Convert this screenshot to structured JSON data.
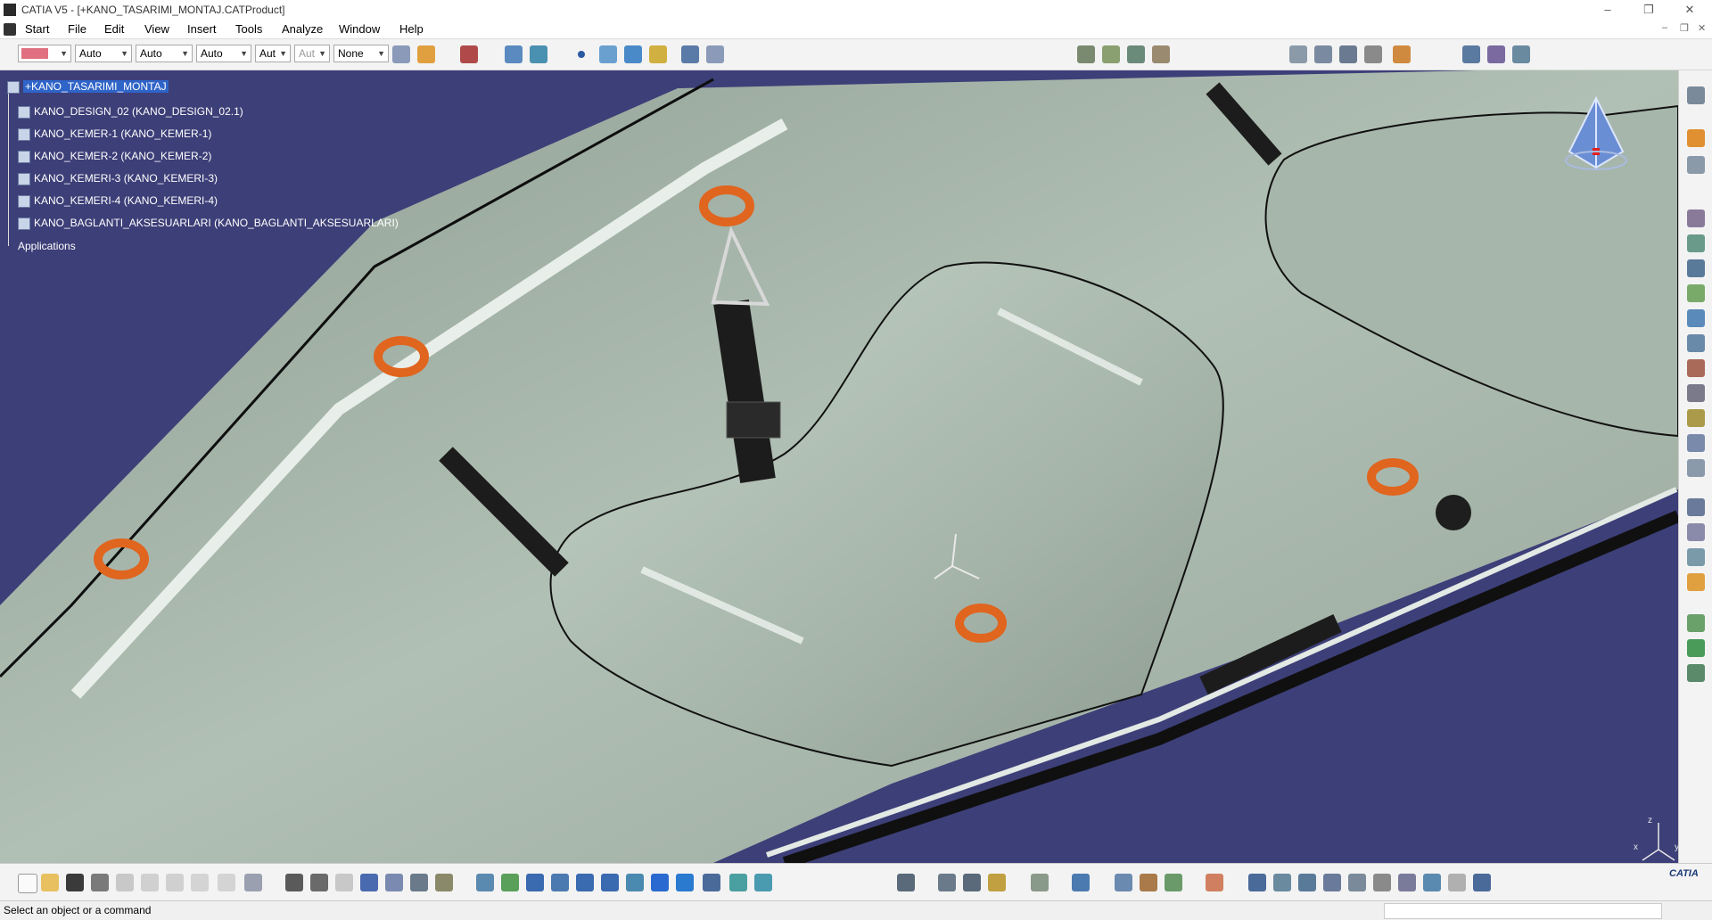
{
  "window": {
    "title": "CATIA V5 - [+KANO_TASARIMI_MONTAJ.CATProduct]",
    "controls": [
      "–",
      "❐",
      "✕"
    ]
  },
  "menu": {
    "items": [
      "Start",
      "File",
      "Edit",
      "View",
      "Insert",
      "Tools",
      "Analyze",
      "Window",
      "Help"
    ],
    "mdi_controls": [
      "–",
      "❐",
      "✕"
    ]
  },
  "graphic_properties": {
    "color_swatch": "#e07080",
    "combos": [
      "Auto",
      "Auto",
      "Auto",
      "Aut",
      "Aut",
      "None"
    ]
  },
  "tree": {
    "root": "+KANO_TASARIMI_MONTAJ",
    "children": [
      "KANO_DESIGN_02 (KANO_DESIGN_02.1)",
      "KANO_KEMER-1 (KANO_KEMER-1)",
      "KANO_KEMER-2 (KANO_KEMER-2)",
      "KANO_KEMERI-3 (KANO_KEMERI-3)",
      "KANO_KEMERI-4 (KANO_KEMERI-4)",
      "KANO_BAGLANTI_AKSESUARLARI (KANO_BAGLANTI_AKSESUARLARI)"
    ],
    "applications": "Applications"
  },
  "axis": {
    "x": "x",
    "y": "y",
    "z": "z"
  },
  "status": {
    "text": "Select an object or a command"
  },
  "brand": {
    "logo_text": "CATIA"
  },
  "colors": {
    "viewport_background": "#3d3f78",
    "hull": "#a9b8ad",
    "ring": "#e0651f",
    "tree_selection": "#2f64c8"
  }
}
